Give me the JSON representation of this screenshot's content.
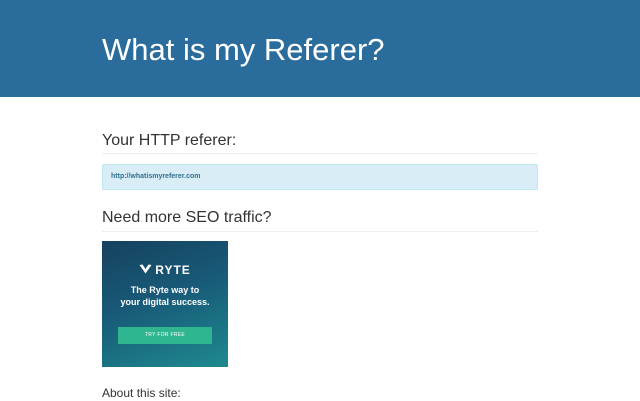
{
  "header": {
    "title": "What is my Referer?",
    "background_color": "#2a6c9c"
  },
  "referer_section": {
    "heading": "Your HTTP referer:",
    "value": "http://whatismyreferer.com",
    "box_color": "#d9edf7"
  },
  "seo_section": {
    "heading": "Need more SEO traffic?",
    "ad": {
      "brand": "RYTE",
      "logo_icon": "ryte-logo-icon",
      "tagline_line1": "The Ryte way to",
      "tagline_line2": "your digital success.",
      "cta_label": "TRY FOR FREE",
      "cta_color": "#2fb58f"
    }
  },
  "about": {
    "label": "About this site:"
  }
}
